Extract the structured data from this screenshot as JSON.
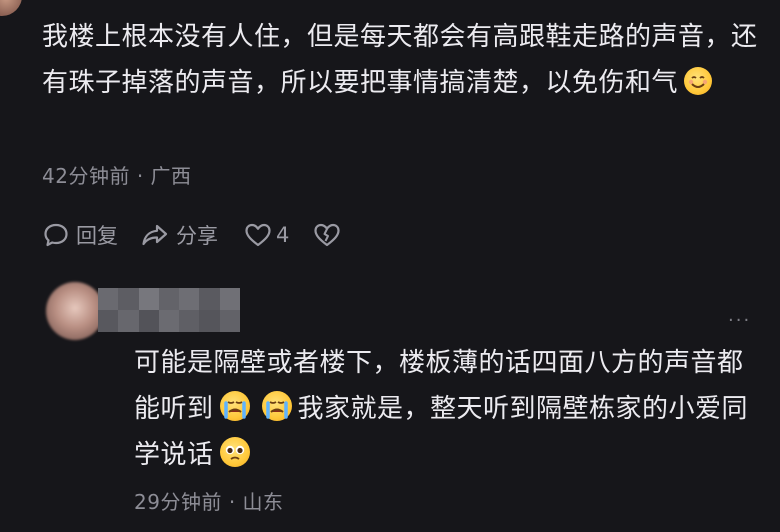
{
  "comment": {
    "text": "我楼上根本没有人住，但是每天都会有高跟鞋走路的声音，还有珠子掉落的声音，所以要把事情搞清楚，以免伤和气",
    "emoji_icon": "smiling-face-emoji",
    "time": "42分钟前",
    "separator": "·",
    "location": "广西"
  },
  "actions": {
    "reply_label": "回复",
    "share_label": "分享",
    "like_count": "4"
  },
  "reply": {
    "more_label": "···",
    "text_part1": "可能是隔壁或者楼下，楼板薄的话四面八方的声音都能听到",
    "text_part2": "我家就是，整天听到隔壁栋家的小爱同学说话",
    "emoji_cry_icon": "loudly-crying-face-emoji",
    "emoji_plead_icon": "pleading-face-emoji",
    "time": "29分钟前",
    "separator": "·",
    "location": "山东"
  }
}
